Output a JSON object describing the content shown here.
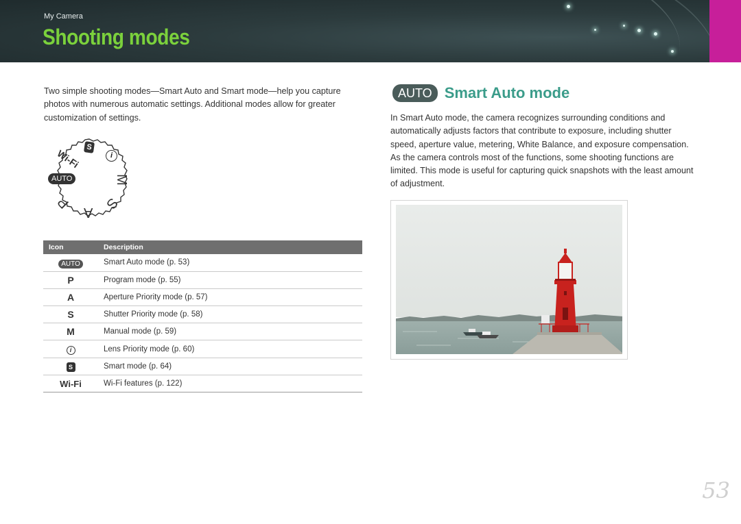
{
  "header": {
    "section_label": "My Camera",
    "title": "Shooting modes"
  },
  "left": {
    "intro": "Two simple shooting modes—Smart Auto and Smart mode—help you capture photos with numerous automatic settings. Additional modes allow for greater customization of settings.",
    "dial_labels": {
      "smart": "S",
      "lens": "i",
      "manual": "M",
      "shutter": "S",
      "aperture": "A",
      "program": "P",
      "auto": "AUTO",
      "wifi": "Wi-Fi"
    },
    "table": {
      "headers": [
        "Icon",
        "Description"
      ],
      "rows": [
        {
          "icon": "AUTO",
          "icon_type": "auto-chip",
          "description": "Smart Auto mode (p. 53)"
        },
        {
          "icon": "P",
          "icon_type": "letter",
          "description": "Program mode (p. 55)"
        },
        {
          "icon": "A",
          "icon_type": "letter",
          "description": "Aperture Priority mode (p. 57)"
        },
        {
          "icon": "S",
          "icon_type": "letter",
          "description": "Shutter Priority mode (p. 58)"
        },
        {
          "icon": "M",
          "icon_type": "letter",
          "description": "Manual mode (p. 59)"
        },
        {
          "icon": "i",
          "icon_type": "lens-icon",
          "description": "Lens Priority mode (p. 60)"
        },
        {
          "icon": "S",
          "icon_type": "smart-icon",
          "description": "Smart mode (p. 64)"
        },
        {
          "icon": "Wi-Fi",
          "icon_type": "wifi-text",
          "description": "Wi-Fi features (p. 122)"
        }
      ]
    }
  },
  "right": {
    "badge": "AUTO",
    "heading": "Smart Auto mode",
    "body": "In Smart Auto mode, the camera recognizes surrounding conditions and automatically adjusts factors that contribute to exposure, including shutter speed, aperture value, metering, White Balance, and exposure compensation. As the camera controls most of the functions, some shooting functions are limited. This mode is useful for capturing quick snapshots with the least amount of adjustment."
  },
  "page_number": "53",
  "colors": {
    "banner": "#2c3b3d",
    "title_green": "#7bd13c",
    "tab_magenta": "#c71f9a",
    "heading_teal": "#3b9c8a",
    "lighthouse_red": "#c8221e"
  }
}
